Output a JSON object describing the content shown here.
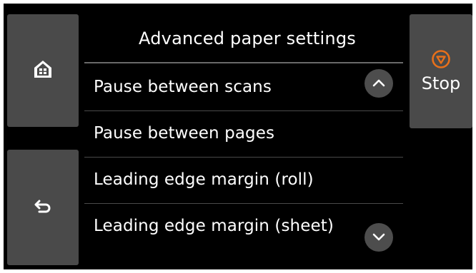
{
  "header": {
    "title": "Advanced paper settings"
  },
  "menu": {
    "items": [
      {
        "label": "Pause between scans"
      },
      {
        "label": "Pause between pages"
      },
      {
        "label": "Leading edge margin (roll)"
      },
      {
        "label": "Leading edge margin (sheet)"
      }
    ]
  },
  "controls": {
    "stop_label": "Stop",
    "home_icon": "home-icon",
    "back_icon": "back-arrow-icon",
    "stop_icon": "stop-icon",
    "scroll_up_icon": "chevron-up-icon",
    "scroll_down_icon": "chevron-down-icon"
  },
  "colors": {
    "background": "#000000",
    "panel": "#4a4a4a",
    "text": "#ffffff",
    "stop_accent": "#e8701a"
  }
}
